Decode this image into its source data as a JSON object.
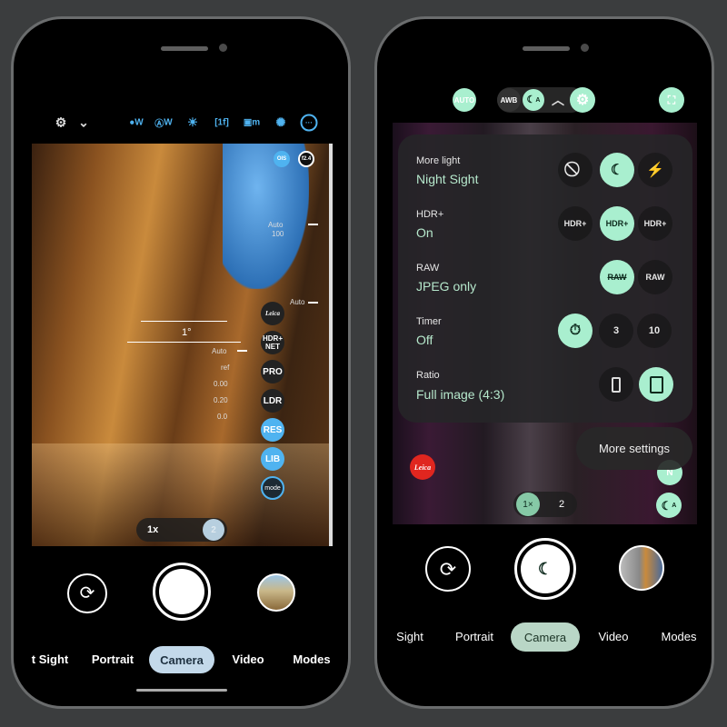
{
  "left_phone": {
    "top_bar": {
      "icons": [
        "camera-settings-icon",
        "chevron-down-icon",
        "white-balance-warm-icon",
        "auto-white-balance-icon",
        "sunrise-icon",
        "frame-1f-icon",
        "metering-icon",
        "aperture-icon",
        "more-icon"
      ],
      "labels": {
        "wb1": "W",
        "wb2": "W",
        "frame": "[1f]",
        "metering": "m"
      }
    },
    "viewfinder": {
      "ois": "OIS",
      "aperture": "f2.4",
      "exposure_value": "1°",
      "side_readouts": [
        "Auto",
        "100",
        "Auto",
        "Auto",
        "ref",
        "0.00",
        "0.20",
        "0.0"
      ],
      "side_buttons": [
        "HDR+ NET",
        "PRO",
        "LDR",
        "RES",
        "LIB",
        "mode"
      ],
      "leica_logo": "Leica",
      "zoom": {
        "option1": "1x",
        "option2": "2"
      }
    },
    "controls": {
      "switch_camera": "switch-camera-icon",
      "shutter": "shutter-button",
      "gallery": "gallery-thumbnail"
    },
    "modes": [
      "t Sight",
      "Portrait",
      "Camera",
      "Video",
      "Modes"
    ],
    "active_mode": "Camera",
    "accent": "#4fb3f0",
    "active_mode_color": "#c3d9ea"
  },
  "right_phone": {
    "top_bar": {
      "auto": "AUTO",
      "awb": "AWB",
      "night": "A",
      "icons": [
        "night-sight-auto-icon",
        "chevron-up-icon",
        "gear-icon",
        "lens-icon"
      ]
    },
    "quick_settings": [
      {
        "label": "More light",
        "value": "Night Sight",
        "options": [
          "off-icon",
          "night-sight-auto-icon",
          "flash-icon"
        ],
        "selected": 1
      },
      {
        "label": "HDR+",
        "value": "On",
        "options": [
          "HDR+",
          "HDR+",
          "HDR+"
        ],
        "selected": 1
      },
      {
        "label": "RAW",
        "value": "JPEG only",
        "options": [
          "RAW",
          "RAW"
        ],
        "selected": 0
      },
      {
        "label": "Timer",
        "value": "Off",
        "options": [
          "timer-off-icon",
          "3",
          "10"
        ],
        "selected": 0
      },
      {
        "label": "Ratio",
        "value": "Full image (4:3)",
        "options": [
          "ratio-tall-icon",
          "ratio-4-3-icon"
        ],
        "selected": 1
      }
    ],
    "more_settings": "More settings",
    "leica_logo": "Leica",
    "n_button": "N",
    "night_badge": "A",
    "zoom": {
      "option1": "1×",
      "option2": "2"
    },
    "modes": [
      "Sight",
      "Portrait",
      "Camera",
      "Video",
      "Modes"
    ],
    "active_mode": "Camera",
    "accent": "#a9efcf",
    "active_mode_color": "#b9d6c6"
  }
}
